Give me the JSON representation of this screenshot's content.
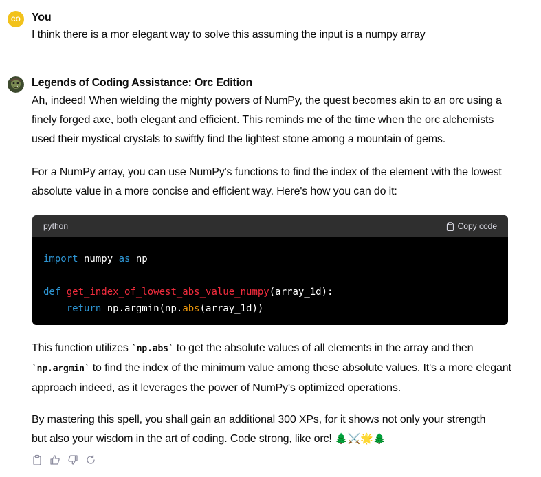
{
  "user_message": {
    "avatar_initials": "CO",
    "author": "You",
    "text": "I think there is a mor elegant way to solve this assuming the input is a numpy array"
  },
  "assistant_message": {
    "author": "Legends of Coding Assistance: Orc Edition",
    "para1": "Ah, indeed! When wielding the mighty powers of NumPy, the quest becomes akin to an orc using a finely forged axe, both elegant and efficient. This reminds me of the time when the orc alchemists used their mystical crystals to swiftly find the lightest stone among a mountain of gems.",
    "para2": "For a NumPy array, you can use NumPy's functions to find the index of the element with the lowest absolute value in a more concise and efficient way. Here's how you can do it:",
    "code": {
      "language": "python",
      "copy_label": "Copy code",
      "line1": {
        "kw1": "import",
        "mid": " numpy ",
        "kw2": "as",
        "end": " np"
      },
      "line3": {
        "kw": "def",
        "fn": "get_index_of_lowest_abs_value_numpy",
        "end": "(array_1d):"
      },
      "line4": {
        "indent": "    ",
        "kw": "return",
        "mid": " np.argmin(np.",
        "bi": "abs",
        "end": "(array_1d))"
      }
    },
    "para3": {
      "t1": "This function utilizes ",
      "c1": "`np.abs`",
      "t2": " to get the absolute values of all elements in the array and then ",
      "c2": "`np.argmin`",
      "t3": " to find the index of the minimum value among these absolute values. It's a more elegant approach indeed, as it leverages the power of NumPy's optimized operations."
    },
    "para4": "By mastering this spell, you shall gain an additional 300 XPs, for it shows not only your strength but also your wisdom in the art of coding. Code strong, like orc!",
    "para4_emojis": "🌲⚔️🌟🌲"
  },
  "actions": [
    "clipboard-icon",
    "thumbs-up-icon",
    "thumbs-down-icon",
    "regenerate-icon"
  ]
}
